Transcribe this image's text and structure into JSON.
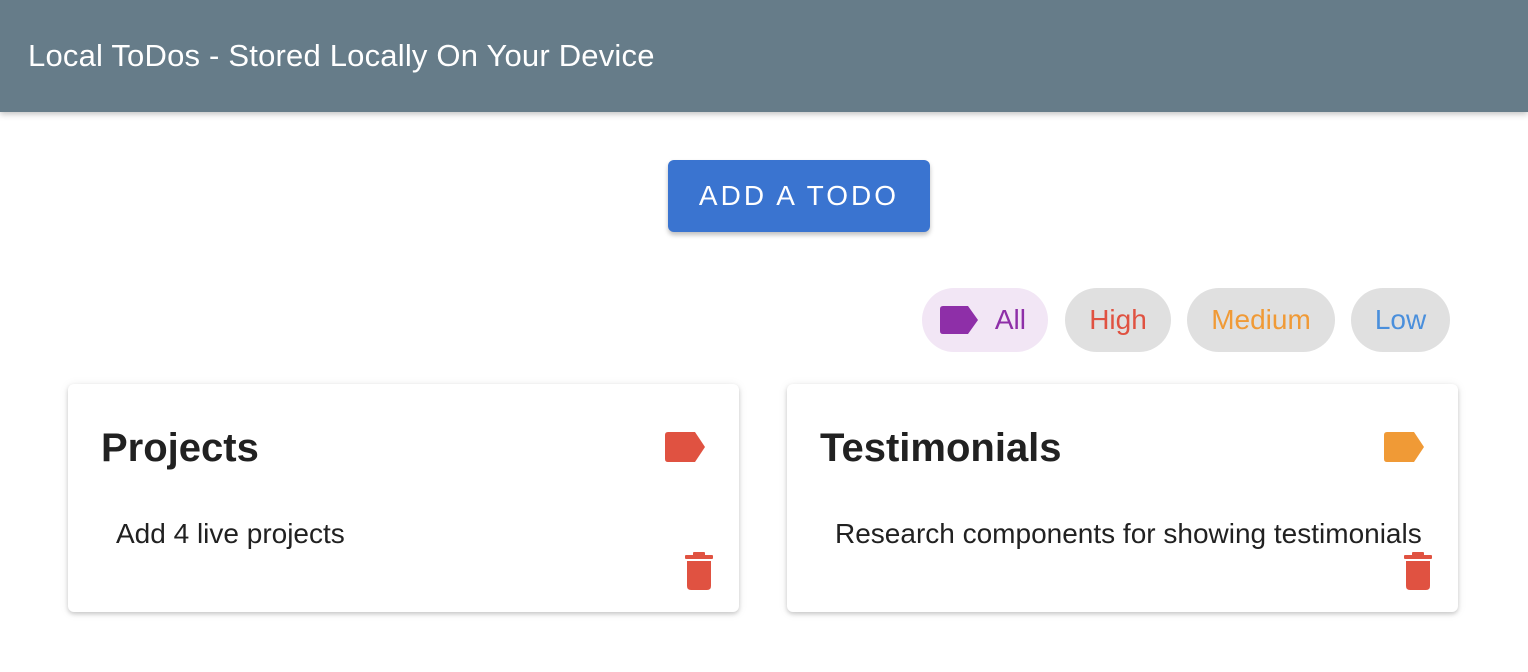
{
  "app": {
    "title": "Local ToDos - Stored Locally On Your Device"
  },
  "actions": {
    "add_label": "ADD A TODO"
  },
  "filters": {
    "selected": "All",
    "chips": [
      {
        "label": "All",
        "color": "#8e2fa8",
        "icon": "label-icon"
      },
      {
        "label": "High",
        "color": "#e05241"
      },
      {
        "label": "Medium",
        "color": "#f09a36"
      },
      {
        "label": "Low",
        "color": "#4a8fdc"
      }
    ]
  },
  "todos": [
    {
      "title": "Projects",
      "text": "Add 4 live projects",
      "priority": "High",
      "priority_color": "#e05241",
      "icon": "label-icon"
    },
    {
      "title": "Testimonials",
      "text": "Research components for showing testimonials",
      "priority": "Medium",
      "priority_color": "#f09a36",
      "icon": "label-icon"
    }
  ],
  "colors": {
    "appbar": "#667c89",
    "primary": "#3a74d0",
    "delete": "#e05241"
  }
}
